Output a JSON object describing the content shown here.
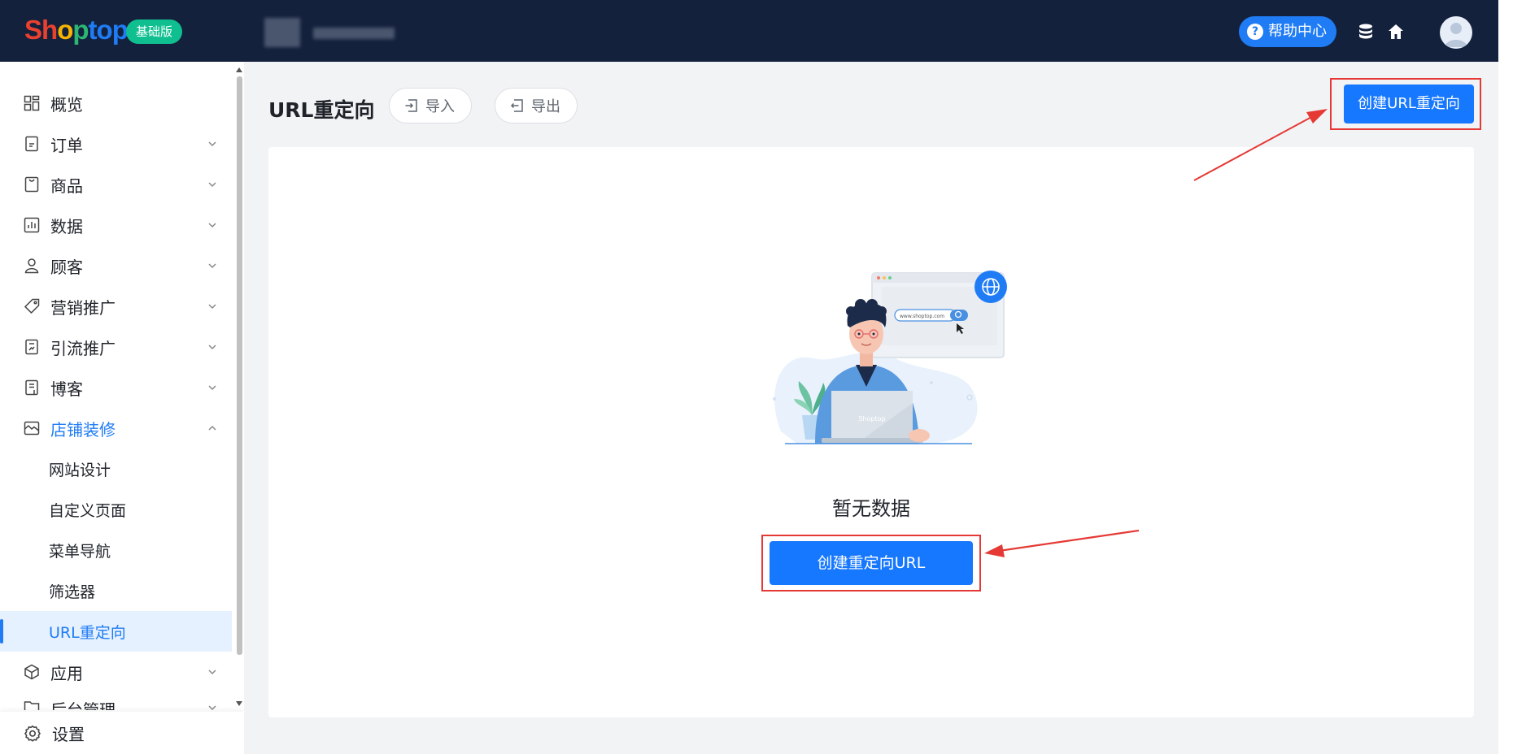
{
  "header": {
    "logo": {
      "letters": [
        "S",
        "h",
        "o",
        "p",
        "t",
        "o",
        "p"
      ],
      "colors": [
        "#e8412f",
        "#e8412f",
        "#f6b400",
        "#2bb673",
        "#1f7cf5",
        "#1f7cf5",
        "#1f7cf5"
      ]
    },
    "plan_badge": "基础版",
    "help_label": "帮助中心",
    "icons": {
      "database": "database-icon",
      "home": "home-icon",
      "avatar": "user-avatar-icon"
    }
  },
  "sidebar": {
    "items": [
      {
        "label": "概览",
        "icon": "dashboard-icon",
        "expandable": false
      },
      {
        "label": "订单",
        "icon": "order-icon",
        "expandable": true
      },
      {
        "label": "商品",
        "icon": "product-icon",
        "expandable": true
      },
      {
        "label": "数据",
        "icon": "chart-icon",
        "expandable": true
      },
      {
        "label": "顾客",
        "icon": "customer-icon",
        "expandable": true
      },
      {
        "label": "营销推广",
        "icon": "tag-icon",
        "expandable": true
      },
      {
        "label": "引流推广",
        "icon": "traffic-icon",
        "expandable": true
      },
      {
        "label": "博客",
        "icon": "blog-icon",
        "expandable": true
      },
      {
        "label": "店铺装修",
        "icon": "store-icon",
        "expandable": true,
        "expanded": true
      },
      {
        "label": "应用",
        "icon": "app-icon",
        "expandable": true
      },
      {
        "label": "后台管理",
        "icon": "folder-icon",
        "expandable": true
      }
    ],
    "sub_items": [
      {
        "label": "网站设计"
      },
      {
        "label": "自定义页面"
      },
      {
        "label": "菜单导航"
      },
      {
        "label": "筛选器"
      },
      {
        "label": "URL重定向",
        "current": true
      }
    ],
    "settings_label": "设置"
  },
  "main": {
    "title": "URL重定向",
    "import_label": "导入",
    "export_label": "导出",
    "create_top_label": "创建URL重定向",
    "empty_text": "暂无数据",
    "create_center_label": "创建重定向URL",
    "illustration": {
      "url_text": "www.shoptop.com",
      "laptop_text": "Shoptop"
    }
  },
  "colors": {
    "header_bg": "#14213d",
    "primary": "#1677ff",
    "badge": "#0fbf90",
    "annotation": "#e53935"
  }
}
